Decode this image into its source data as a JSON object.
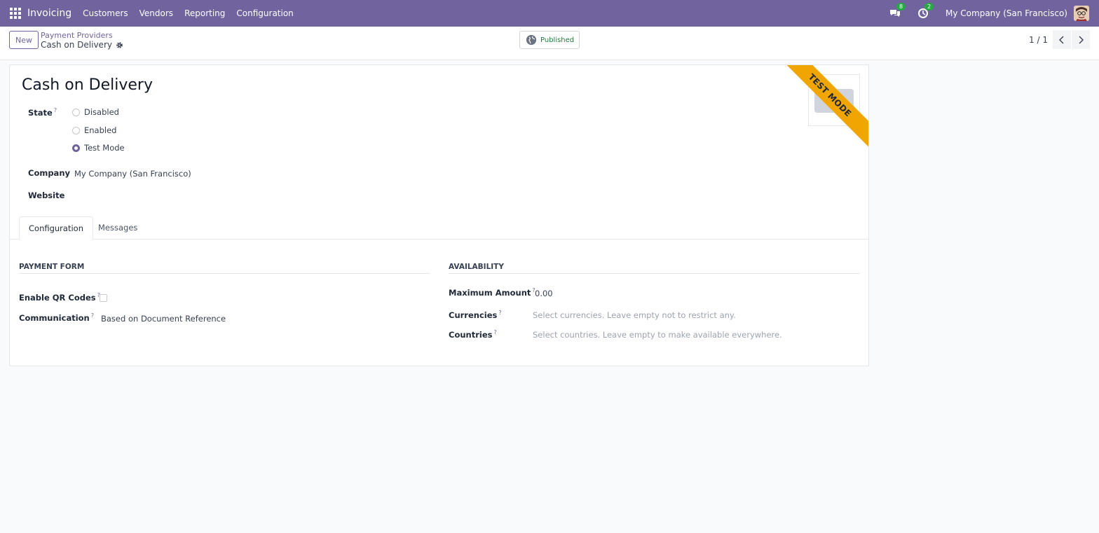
{
  "navbar": {
    "app_name": "Invoicing",
    "menu": [
      "Customers",
      "Vendors",
      "Reporting",
      "Configuration"
    ],
    "messages_count": "8",
    "activities_count": "2",
    "company": "My Company (San Francisco)"
  },
  "control_panel": {
    "new_label": "New",
    "breadcrumb_parent": "Payment Providers",
    "breadcrumb_current": "Cash on Delivery",
    "published_label": "Published",
    "pager": "1 / 1"
  },
  "form": {
    "title": "Cash on Delivery",
    "ribbon": "TEST MODE",
    "state_label": "State",
    "state_help": "?",
    "state_options": [
      {
        "label": "Disabled",
        "checked": false
      },
      {
        "label": "Enabled",
        "checked": false
      },
      {
        "label": "Test Mode",
        "checked": true
      }
    ],
    "company_label": "Company",
    "company_value": "My Company (San Francisco)",
    "website_label": "Website",
    "tabs": [
      "Configuration",
      "Messages"
    ],
    "payment_form": {
      "title": "PAYMENT FORM",
      "qr_label": "Enable QR Codes",
      "qr_checked": false,
      "communication_label": "Communication",
      "communication_value": "Based on Document Reference"
    },
    "availability": {
      "title": "AVAILABILITY",
      "max_amount_label": "Maximum Amount",
      "max_amount_value": "0.00",
      "currencies_label": "Currencies",
      "currencies_placeholder": "Select currencies. Leave empty not to restrict any.",
      "countries_label": "Countries",
      "countries_placeholder": "Select countries. Leave empty to make available everywhere."
    },
    "help_mark": "?"
  },
  "colors": {
    "brand": "#71639e",
    "ribbon": "#f0a500",
    "badge": "#28a745"
  }
}
